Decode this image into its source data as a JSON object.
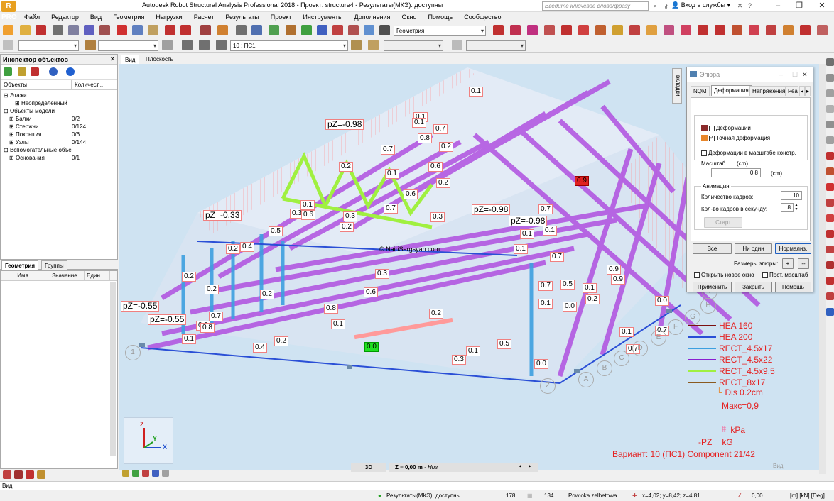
{
  "window": {
    "title": "Autodesk Robot Structural Analysis Professional 2018 - Проект: structure4 - Результаты(МКЭ): доступны",
    "search_placeholder": "Введите ключевое слово/фразу",
    "login": "Вход в службы",
    "logo": "R PRO"
  },
  "menu": [
    "Файл",
    "Редактор",
    "Вид",
    "Геометрия",
    "Нагрузки",
    "Расчет",
    "Результаты",
    "Проект",
    "Инструменты",
    "Дополнения",
    "Окно",
    "Помощь",
    "Сообщество"
  ],
  "toolbar": {
    "geometry_combo": "Геометрия",
    "load_case_combo": "10 : ПС1"
  },
  "inspector": {
    "title": "Инспектор объектов",
    "col_objects": "Объекты",
    "col_count": "Количест...",
    "tree": [
      {
        "label": "Этажи",
        "count": "",
        "indent": 0
      },
      {
        "label": "Неопределенный",
        "count": "",
        "indent": 2
      },
      {
        "label": "Объекты модели",
        "count": "",
        "indent": 0
      },
      {
        "label": "Балки",
        "count": "0/2",
        "indent": 1
      },
      {
        "label": "Стержни",
        "count": "0/124",
        "indent": 1
      },
      {
        "label": "Покрытия",
        "count": "0/6",
        "indent": 1
      },
      {
        "label": "Узлы",
        "count": "0/144",
        "indent": 1
      },
      {
        "label": "Вспомогательные объекты",
        "count": "",
        "indent": 0
      },
      {
        "label": "Основания",
        "count": "0/1",
        "indent": 1
      }
    ],
    "tabs": [
      "Геометрия",
      "Группы"
    ],
    "props_head": [
      "Имя",
      "Значение",
      "Един"
    ]
  },
  "view_tabs": [
    "Вид",
    "Плоскость"
  ],
  "viewport": {
    "watermark": "© NairiSargsyan.com",
    "pz_labels": [
      "pZ=-0.98",
      "pZ=-0.33",
      "pZ=-0.98",
      "pZ=-0.98",
      "pZ=-0.55",
      "pZ=-0.55"
    ],
    "value_labels": [
      "0.1",
      "0.1",
      "0.7",
      "0.8",
      "0.7",
      "0.1",
      "0.2",
      "0.6",
      "0.2",
      "0.6",
      "0.1",
      "0.2",
      "0.3",
      "0.1",
      "0.6",
      "0.3",
      "0.2",
      "0.7",
      "0.3",
      "0.5",
      "0.2",
      "0.4",
      "0.2",
      "0.2",
      "0.7",
      "0.1",
      "0.1",
      "0.7",
      "0.3",
      "0.2",
      "0.6",
      "0.9",
      "0.9",
      "0.1",
      "0.7",
      "0.5",
      "0.1",
      "0.2",
      "0.0",
      "0.1",
      "0.0",
      "0.7",
      "0.8",
      "0.1",
      "0.2",
      "0.1",
      "0.3",
      "0.4",
      "0.2",
      "0.1",
      "0.5",
      "0.0",
      "0.7",
      "0.7",
      "0.0",
      "0.1",
      "0.8"
    ],
    "max_label": "0.9",
    "zero_label": "0.0",
    "node_labels": [
      "1",
      "Z",
      "A",
      "B",
      "C",
      "D",
      "E",
      "F",
      "G",
      "H",
      "I"
    ],
    "axis": {
      "z": "Z",
      "y": "Y",
      "x": "X"
    },
    "legend": [
      {
        "name": "HEA 160",
        "color": "#7b1010"
      },
      {
        "name": "HEA 200",
        "color": "#2a4fd6"
      },
      {
        "name": "RECT_4.5x17",
        "color": "#3da0e0"
      },
      {
        "name": "RECT_4.5x22",
        "color": "#8a1fd0"
      },
      {
        "name": "RECT_4.5x9.5",
        "color": "#a0f040"
      },
      {
        "name": "RECT_8x17",
        "color": "#8a5a20"
      }
    ],
    "legend_text": {
      "dis": "Dis  0.2cm",
      "max": "Макс=0,9",
      "kpa": "kPa",
      "pz": "-PZ",
      "kg": "kG",
      "variant": "Вариант: 10 (ПС1) Component 21/42"
    },
    "bottom_3d": "3D",
    "bottom_z": "Z = 0,00 m",
    "bottom_niz": " - Низ",
    "bottom_vid": "Вид"
  },
  "vert_tab": "вкладки",
  "dialog": {
    "title": "Эпюра",
    "tabs": [
      "NQM",
      "Деформация",
      "Напряжения",
      "Реа"
    ],
    "active_tab": "Деформация",
    "deformation_label": "Деформации",
    "exact_label": "Точная  деформация",
    "scale_constr_label": "Деформации в масштабе констр.",
    "scale_label": "Масштаб",
    "scale_unit_top": "(cm)",
    "scale_value": "0,8",
    "scale_unit": "(cm)",
    "animation_group": "Анимация",
    "frames_label": "Количество кадров:",
    "frames_value": "10",
    "fps_label": "Кол-во кадров в секунду:",
    "fps_value": "8",
    "start_button": "Старт",
    "all_button": "Все",
    "none_button": "Ни один",
    "normalize_button": "Нормализ.",
    "sizes_label": "Размеры эпюры:",
    "plus": "+",
    "minus": "--",
    "open_new_label": "Открыть новое окно",
    "const_scale_label": "Пост. масштаб",
    "apply_button": "Применить",
    "close_button": "Закрыть",
    "help_button": "Помощь",
    "swatch_def": "#8b2a2a",
    "swatch_exact": "#e8862a"
  },
  "status": {
    "view_label": "Вид",
    "results": "Результаты(МКЭ): доступны",
    "n178": "178",
    "n134": "134",
    "material": "Powloka zelbetowa",
    "coords": "x=4,02; y=8,42; z=4,81",
    "value": "0,00",
    "units": "[m] [kN] [Deg]"
  }
}
